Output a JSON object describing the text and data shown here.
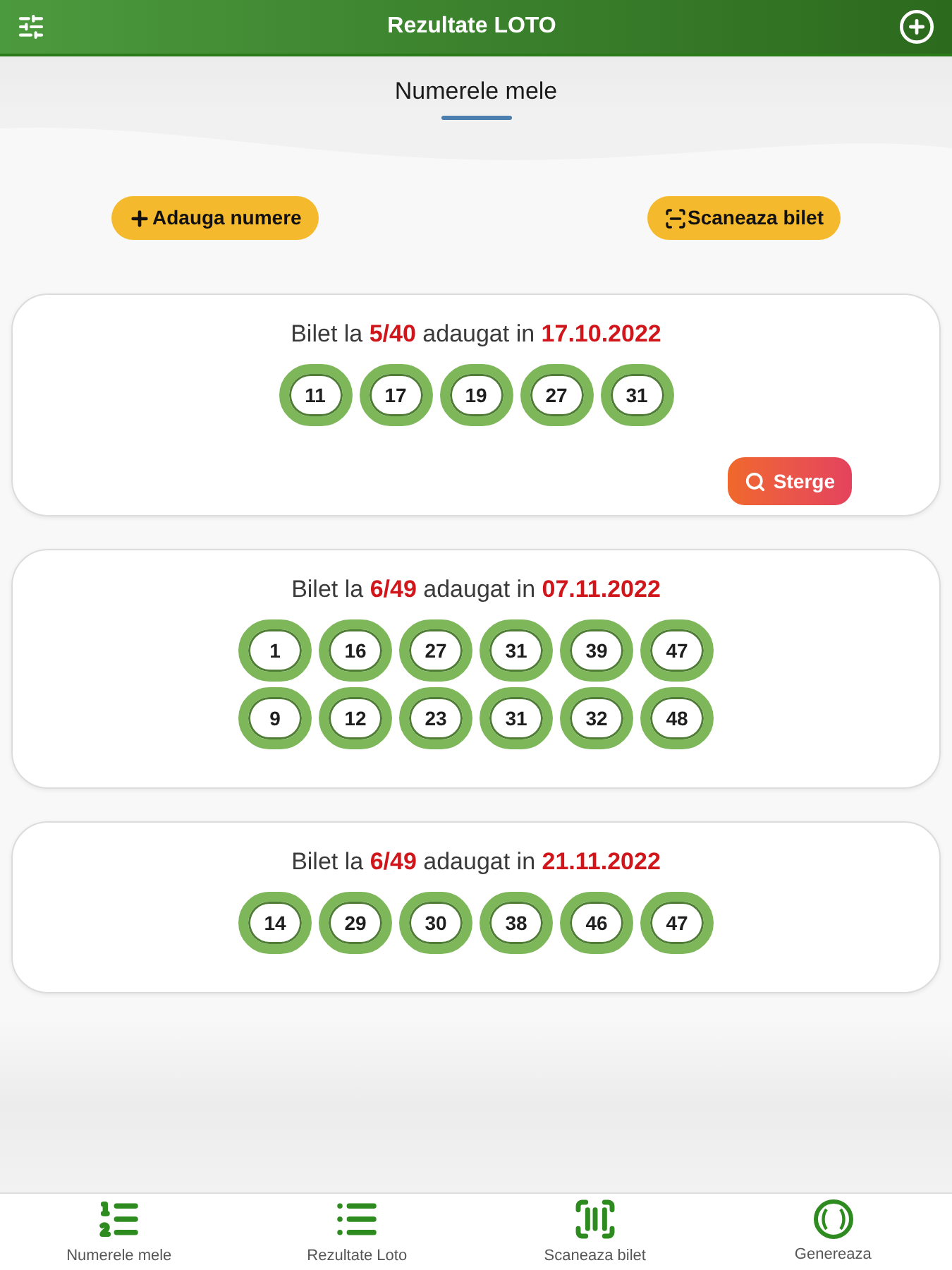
{
  "app_bar": {
    "title": "Rezultate LOTO"
  },
  "page_title": "Numerele mele",
  "actions": [
    {
      "kind": "add",
      "label": "Adauga numere"
    },
    {
      "kind": "scan",
      "label": "Scaneaza bilet"
    }
  ],
  "tickets": [
    {
      "heading": "Bilet la **5/40** adaugat in **17.10.2022**",
      "rows": [
        [
          "11",
          "17",
          "19",
          "27",
          "31"
        ]
      ],
      "delete_button": "Sterge"
    },
    {
      "heading": "Bilet la **6/49** adaugat in **07.11.2022**",
      "rows": [
        [
          "1",
          "16",
          "27",
          "31",
          "39",
          "47"
        ],
        [
          "9",
          "12",
          "23",
          "31",
          "32",
          "48"
        ]
      ]
    },
    {
      "heading": "Bilet la **6/49** adaugat in **21.11.2022**",
      "rows": [
        [
          "14",
          "29",
          "30",
          "38",
          "46",
          "47"
        ]
      ]
    }
  ],
  "bottom_nav": [
    {
      "kind": "numbers",
      "label": "Numerele mele"
    },
    {
      "kind": "results",
      "label": "Rezultate Loto"
    },
    {
      "kind": "scan",
      "label": "Scaneaza bilet"
    },
    {
      "kind": "generate",
      "label": "Genereaza"
    }
  ]
}
